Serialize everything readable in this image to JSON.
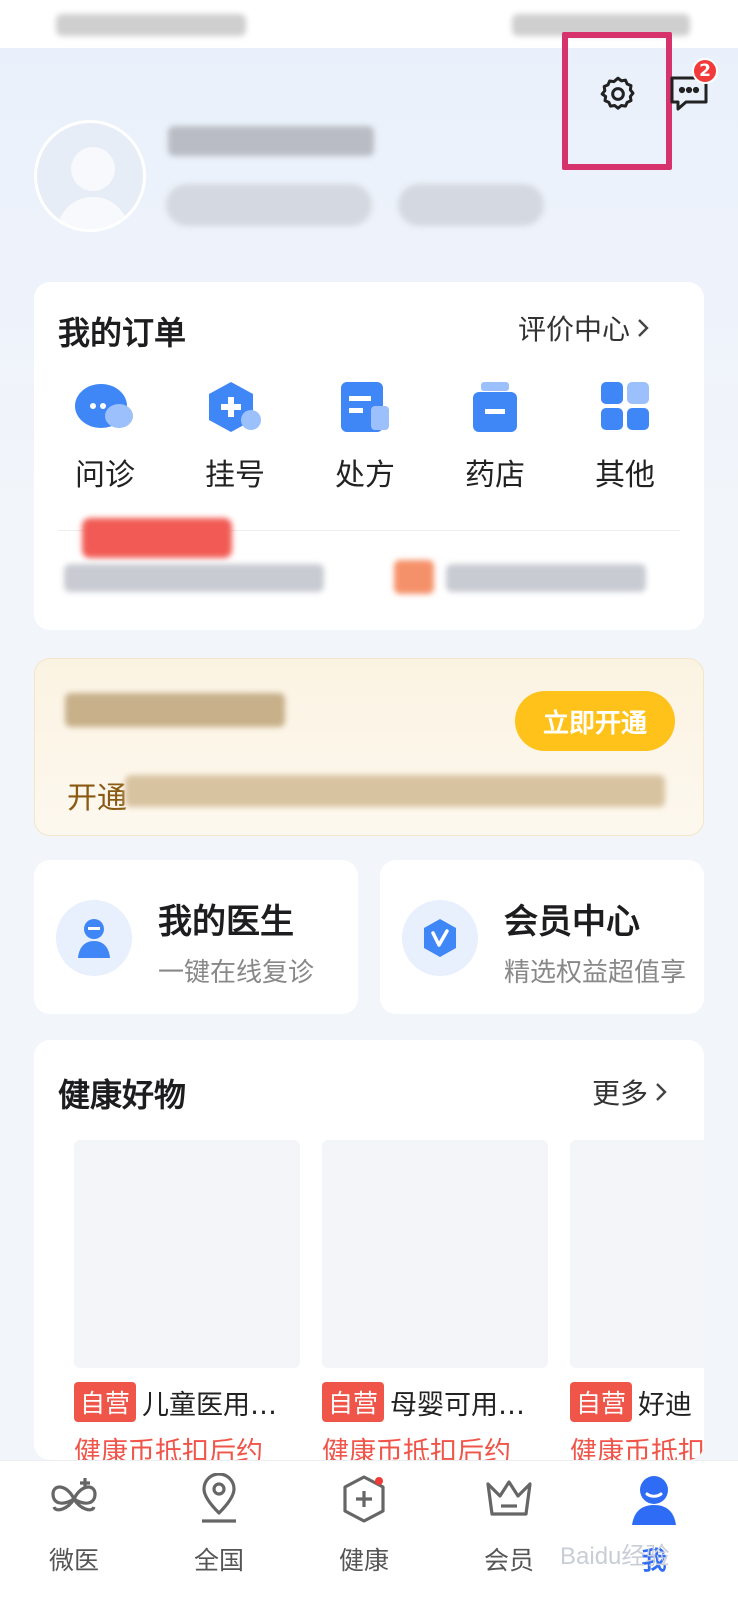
{
  "header": {
    "message_badge": "2"
  },
  "orders": {
    "title": "我的订单",
    "review_link": "评价中心",
    "items": [
      {
        "label": "问诊",
        "icon": "chat-bubble-icon"
      },
      {
        "label": "挂号",
        "icon": "hex-plus-icon"
      },
      {
        "label": "处方",
        "icon": "document-icon"
      },
      {
        "label": "药店",
        "icon": "medicine-bottle-icon"
      },
      {
        "label": "其他",
        "icon": "grid-icon"
      }
    ]
  },
  "promo": {
    "open_button": "立即开通",
    "subtitle_visible": "开通"
  },
  "shortcuts": {
    "doctor": {
      "title": "我的医生",
      "subtitle": "一键在线复诊"
    },
    "member": {
      "title": "会员中心",
      "subtitle": "精选权益超值享"
    }
  },
  "goods": {
    "title": "健康好物",
    "more_link": "更多",
    "products": [
      {
        "tag": "自营",
        "name": "儿童医用…",
        "price_text": "健康币抵扣后约"
      },
      {
        "tag": "自营",
        "name": "母婴可用…",
        "price_text": "健康币抵扣后约"
      },
      {
        "tag": "自营",
        "name": "好迪",
        "price_text": "健康币抵扣"
      }
    ]
  },
  "tabbar": {
    "tabs": [
      {
        "label": "微医",
        "icon": "butterfly-logo-icon",
        "active": false
      },
      {
        "label": "全国",
        "icon": "location-pin-icon",
        "active": false
      },
      {
        "label": "健康",
        "icon": "hex-plus-icon",
        "active": false
      },
      {
        "label": "会员",
        "icon": "crown-icon",
        "active": false
      },
      {
        "label": "我",
        "icon": "person-icon",
        "active": true
      }
    ]
  },
  "watermark": "Baidu经验",
  "colors": {
    "accent_blue": "#2f6cf5",
    "badge_red": "#f23a3a",
    "tag_red": "#f0554a",
    "promo_button": "#ffc21a",
    "highlight_box": "#d6336c"
  }
}
